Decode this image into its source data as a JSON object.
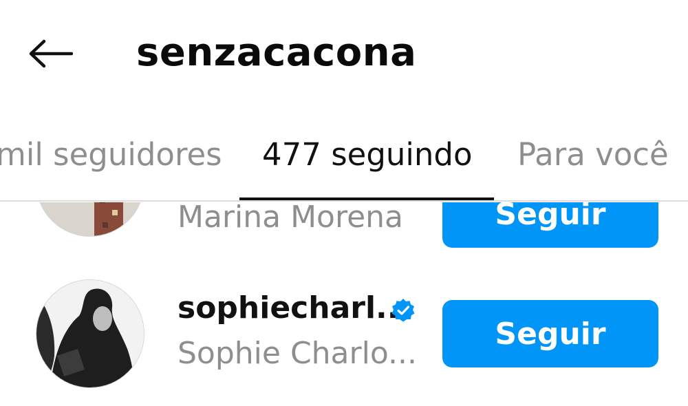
{
  "header": {
    "title": "senzacacona",
    "back_icon": "arrow-left-icon"
  },
  "tabs": [
    {
      "label": "mil seguidores",
      "active": false
    },
    {
      "label": "477 seguindo",
      "active": true
    },
    {
      "label": "Para você",
      "active": false
    }
  ],
  "users": [
    {
      "username": "",
      "full_name": "Marina Morena",
      "verified": false,
      "button_label": "Seguir"
    },
    {
      "username": "sophiecharl...",
      "full_name": "Sophie Charlo...",
      "verified": true,
      "button_label": "Seguir"
    }
  ],
  "colors": {
    "accent": "#0095f6",
    "secondary_text": "#8e8e8e",
    "verified_badge": "#0095f6"
  }
}
